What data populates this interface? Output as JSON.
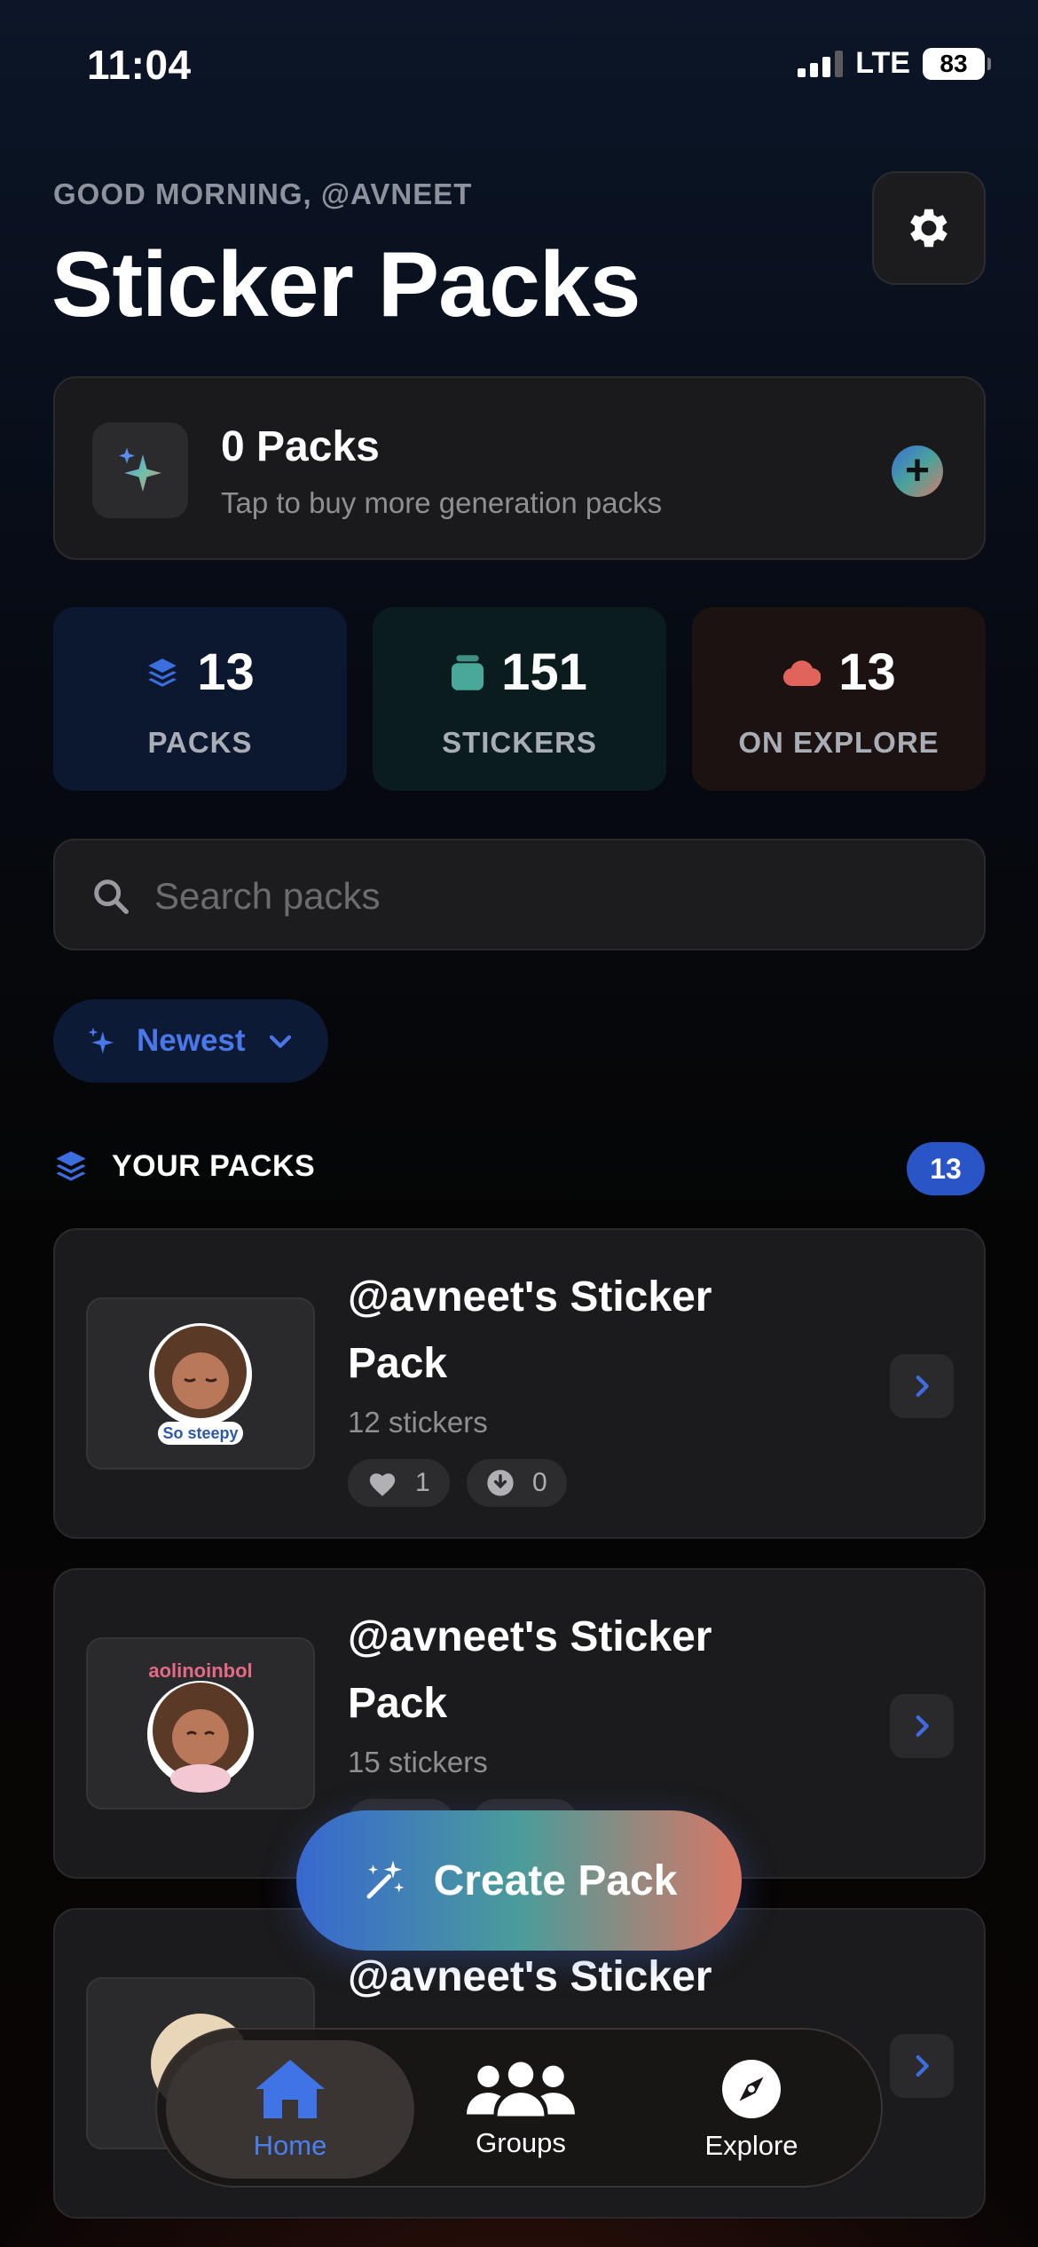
{
  "status_bar": {
    "time": "11:04",
    "network": "LTE",
    "battery": "83"
  },
  "header": {
    "greeting": "GOOD MORNING, @AVNEET",
    "title": "Sticker Packs"
  },
  "credits": {
    "title": "0 Packs",
    "subtitle": "Tap to buy more generation packs"
  },
  "stats": [
    {
      "value": "13",
      "label": "PACKS",
      "icon": "layers-icon",
      "color": "#3b6fe0"
    },
    {
      "value": "151",
      "label": "STICKERS",
      "icon": "stickers-icon",
      "color": "#4aa89a"
    },
    {
      "value": "13",
      "label": "ON EXPLORE",
      "icon": "cloud-icon",
      "color": "#e0645c"
    }
  ],
  "search": {
    "placeholder": "Search packs"
  },
  "sort": {
    "label": "Newest"
  },
  "section": {
    "title": "YOUR PACKS",
    "count": "13"
  },
  "packs": [
    {
      "title": "@avneet's Sticker Pack",
      "count": "12 stickers",
      "likes": "1",
      "downloads": "0",
      "thumb_caption": "So steepy"
    },
    {
      "title": "@avneet's Sticker Pack",
      "count": "15 stickers",
      "likes": "",
      "downloads": "",
      "thumb_caption": "aolinoinbol"
    },
    {
      "title": "@avneet's Sticker Pack",
      "count": "",
      "likes": "",
      "downloads": "",
      "thumb_caption": ""
    }
  ],
  "create_button": {
    "label": "Create Pack"
  },
  "tabs": [
    {
      "label": "Home",
      "icon": "home-icon",
      "active": true
    },
    {
      "label": "Groups",
      "icon": "groups-icon",
      "active": false
    },
    {
      "label": "Explore",
      "icon": "compass-icon",
      "active": false
    }
  ],
  "colors": {
    "accent": "#4a78e8",
    "badge": "#2a55c7",
    "card": "#1b1b1d"
  }
}
